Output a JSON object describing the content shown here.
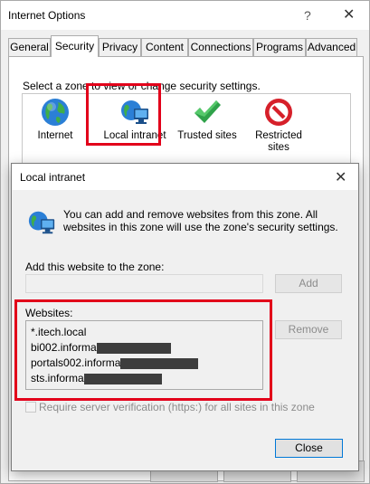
{
  "window": {
    "title": "Internet Options",
    "help_glyph": "?",
    "close_glyph": "✕"
  },
  "tabs": [
    {
      "label": "General"
    },
    {
      "label": "Security",
      "active": true
    },
    {
      "label": "Privacy"
    },
    {
      "label": "Content"
    },
    {
      "label": "Connections"
    },
    {
      "label": "Programs"
    },
    {
      "label": "Advanced"
    }
  ],
  "security": {
    "hint": "Select a zone to view or change security settings.",
    "zones": [
      {
        "label": "Internet",
        "icon": "globe-icon"
      },
      {
        "label": "Local intranet",
        "icon": "local-intranet-icon"
      },
      {
        "label": "Trusted sites",
        "icon": "checkmark-icon"
      },
      {
        "label": "Restricted sites",
        "icon": "restricted-icon"
      }
    ]
  },
  "dialog": {
    "title": "Local intranet",
    "close_glyph": "✕",
    "description": "You can add and remove websites from this zone. All websites in this zone will use the zone's security settings.",
    "add_label": "Add this website to the zone:",
    "add_value": "",
    "add_button": "Add",
    "websites_label": "Websites:",
    "websites": [
      {
        "prefix": "*.itech.local",
        "redacted": false
      },
      {
        "prefix": "bi002.informa",
        "redacted": true
      },
      {
        "prefix": "portals002.informa",
        "redacted": true
      },
      {
        "prefix": "sts.informa",
        "redacted": true
      }
    ],
    "remove_button": "Remove",
    "require_https_label": "Require server verification (https:) for all sites in this zone",
    "require_https_checked": false,
    "close_button": "Close"
  },
  "colors": {
    "highlight": "#e2001a",
    "accent": "#0078d7"
  }
}
